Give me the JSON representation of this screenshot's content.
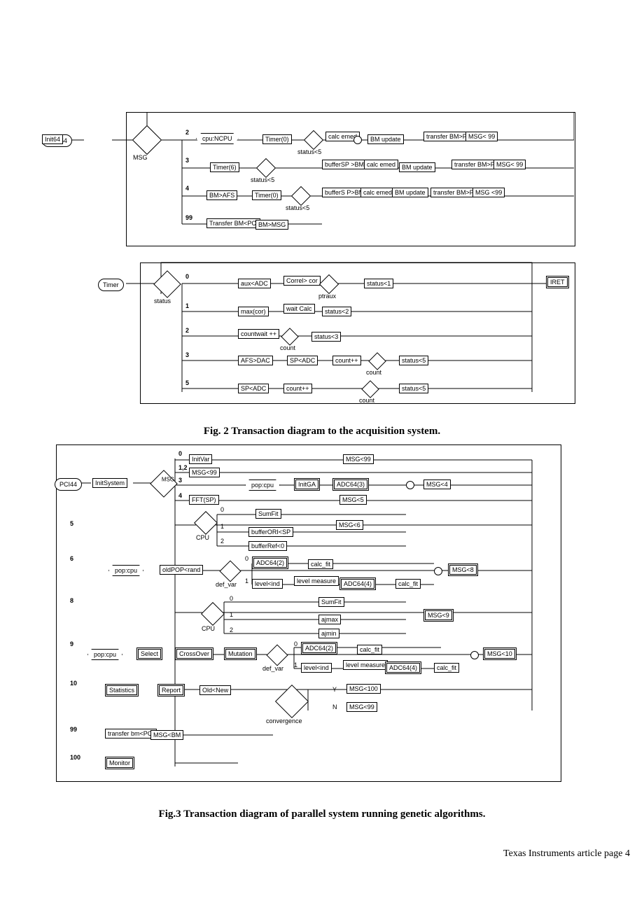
{
  "fig2": {
    "caption": "Fig. 2 Transaction diagram to the acquisition system.",
    "blocks": {
      "adc64": "ADC64",
      "init64": "Init64",
      "msg_decision": "MSG",
      "branch2": "2",
      "cpu_ncpu": "cpu:NCPU",
      "timer0_a": "Timer(0)",
      "status5_a": "status<5",
      "calc_emed_a": "calc\nemed",
      "bm_update_a": "BM update",
      "transfer_bm_pci_a": "transfer\nBM>PCI",
      "msg99_a": "MSG<\n99",
      "branch3": "3",
      "timer6": "Timer(6)",
      "status5_b": "status<5",
      "buffer_sp_bm": "bufferSP\n>BM",
      "calc_emed_b": "calc\nemed",
      "bm_update_b": "BM update",
      "transfer_bm_pci_b": "transfer\nBM>PCI",
      "msg99_b": "MSG<\n99",
      "branch4": "4",
      "bm_afs": "BM>AFS",
      "timer0_b": "Timer(0)",
      "status5_c": "status<5",
      "buffer_sp_bm2": "bufferS\nP>BM",
      "calc_emed_c": "calc\nemed",
      "bm_update_c": "BM\nupdate",
      "transfer_bm_pci_c": "transfer\nBM>PCI",
      "msg99_c": "MSG\n<99",
      "branch99": "99",
      "transfer_bm_pci_d": "Transfer\nBM<PCI",
      "bm_msg": "BM>MSG",
      "timer": "Timer",
      "status_decision": "status",
      "b0": "0",
      "aux_adc": "aux<ADC",
      "correl_cor": "Correl>\ncor",
      "ptraux": "ptraux",
      "status1": "status<1",
      "iret": "IRET",
      "b1": "1",
      "max_cor": "max(cor)",
      "wait_calc": "wait\nCalc",
      "status2": "status<2",
      "b2": "2",
      "countwait": "countwait\n++",
      "count_a": "count",
      "status3": "status<3",
      "b3": "3",
      "afs_dac": "AFS>DAC",
      "sp_adc_a": "SP<ADC",
      "countpp_a": "count++",
      "count_b": "count",
      "status5_d": "status<5",
      "b5": "5",
      "sp_adc_b": "SP<ADC",
      "countpp_b": "count++",
      "count_c": "count",
      "status5_e": "status<5"
    }
  },
  "fig3": {
    "caption": "Fig.3  Transaction diagram of parallel system running genetic algorithms.",
    "blocks": {
      "pci44": "PCI44",
      "initsystem": "InitSystem",
      "msg_decision": "MSG",
      "b0": "0",
      "initvar": "InitVar",
      "msg99_0": "MSG<99",
      "b12": "1,2",
      "msg99_12": "MSG<99",
      "b3": "3",
      "pop_cpu_a": "pop:cpu",
      "initga": "InitGA",
      "adc64_3": "ADC64(3)",
      "msg4": "MSG<4",
      "b4": "4",
      "fft_sp": "FFT(SP)",
      "msg5": "MSG<5",
      "b5": "5",
      "cpu_a": "CPU",
      "cpu_b0": "0",
      "sumfit_a": "SumFit",
      "cpu_b1": "1",
      "buffer_ori": "bufferORI<SP",
      "msg6": "MSG<6",
      "cpu_b2": "2",
      "buffer_ref": "bufferRef<0",
      "b6": "6",
      "pop_cpu_b": "pop:cpu",
      "oldpop_rand": "oldPOP<rand",
      "def_var_a": "def_var",
      "dv_b0": "0",
      "adc64_2_a": "ADC64(2)",
      "calc_fit_a": "calc_fit",
      "dv_b1": "1",
      "level_ind_a": "level<ind",
      "level_measure_a": "level\nmeasure",
      "adc64_4_a": "ADC64(4)",
      "calc_fit_b": "calc_fit",
      "msg8": "MSG<8",
      "b8": "8",
      "cpu_b": "CPU",
      "cpub_0": "0",
      "sumfit_b": "SumFit",
      "cpub_1": "1",
      "ajmax": "ajmax",
      "msg9": "MSG<9",
      "cpub_2": "2",
      "ajmin": "ajmin",
      "b9": "9",
      "pop_cpu_c": "pop:cpu",
      "select": "Select",
      "crossover": "CrossOver",
      "mutation": "Mutation",
      "def_var_b": "def_var",
      "dvb_0": "0",
      "adc64_2_b": "ADC64(2)",
      "calc_fit_c": "calc_fit",
      "dvb_1": "1",
      "level_ind_b": "level<ind",
      "level_measure_b": "level\nmeasure",
      "adc64_4_b": "ADC64(4)",
      "calc_fit_d": "calc_fit",
      "msg10": "MSG<10",
      "b10": "10",
      "statistics": "Statistics",
      "report": "Report",
      "old_new": "Old<New",
      "convergence": "convergence",
      "y": "Y",
      "msg100": "MSG<100",
      "n": "N",
      "msg99_n": "MSG<99",
      "b99": "99",
      "transfer_bm_pci": "transfer\nbm<PCI",
      "msg_bm": "MSG<BM",
      "b100": "100",
      "monitor": "Monitor"
    }
  },
  "footer": "Texas Instruments article page 4"
}
